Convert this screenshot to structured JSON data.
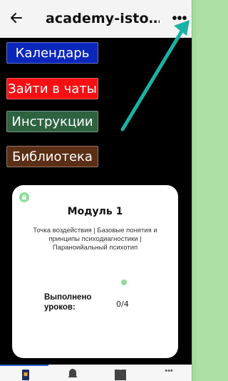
{
  "header": {
    "title": "academy-isto…",
    "back_icon": "back-arrow-icon",
    "more_icon": "more-dots-icon",
    "more_label": "•••"
  },
  "menu_buttons": [
    {
      "label": "Календарь",
      "color": "#0b27ba"
    },
    {
      "label": "Зайти в чаты",
      "color": "#f70f13"
    },
    {
      "label": "Инструкции",
      "color": "#2e6340"
    },
    {
      "label": "Библиотека",
      "color": "#5b2f16"
    }
  ],
  "module_card": {
    "title": "Модуль 1",
    "description": "Точка воздействия | Базовые понятия и принципы психодиагностики | Параноийальный психотип",
    "progress_label": "Выполнено уроков:",
    "progress_value": "0/4",
    "accent": "#8fdc9a"
  },
  "bottom_nav": {
    "tabs": [
      "home-icon",
      "bell-icon",
      "book-icon",
      "more-icon"
    ],
    "more_label": "•••",
    "active_color": "#2d63c8"
  },
  "annotation": {
    "arrow_color": "#19b3a6"
  }
}
